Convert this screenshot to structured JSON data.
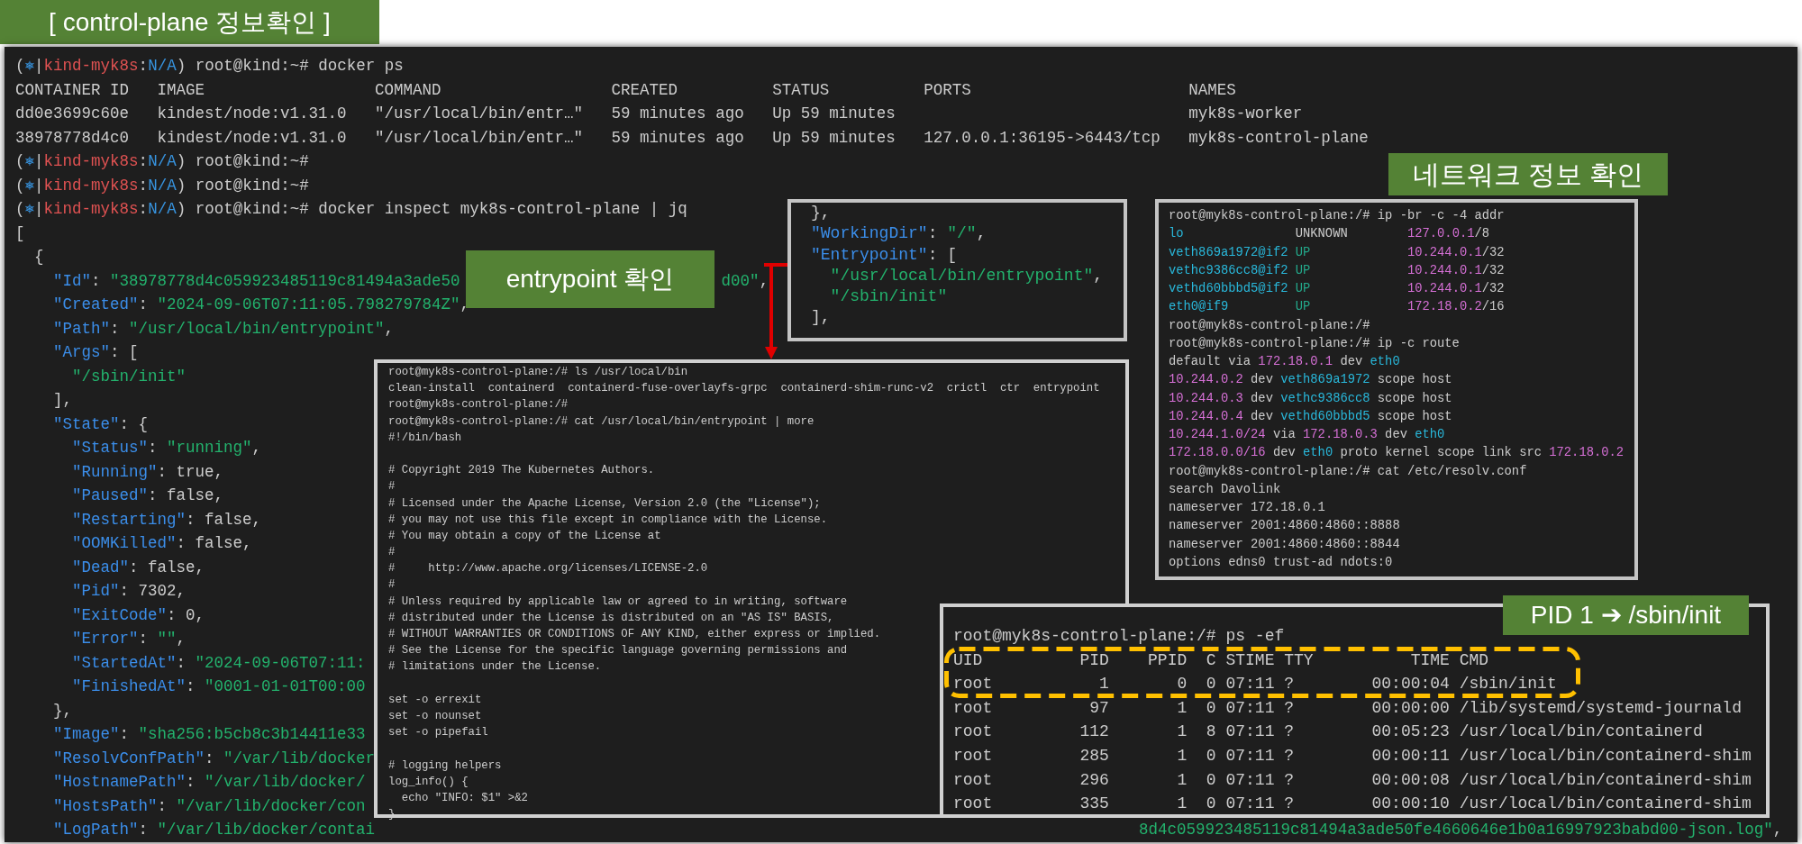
{
  "title_label": "[ control-plane 정보확인 ]",
  "main_terminal": {
    "lines": [
      {
        "segments": [
          {
            "text": "(",
            "kind": "p"
          },
          {
            "text": "⎈",
            "kind": "ns"
          },
          {
            "text": "|",
            "kind": "p"
          },
          {
            "text": "kind-myk8s",
            "kind": "ctx"
          },
          {
            "text": ":",
            "kind": "p"
          },
          {
            "text": "N/A",
            "kind": "ns"
          },
          {
            "text": ") root@kind:~# docker ps",
            "kind": "p"
          }
        ]
      },
      "CONTAINER ID   IMAGE                  COMMAND                  CREATED          STATUS          PORTS                       NAMES",
      "dd0e3699c60e   kindest/node:v1.31.0   \"/usr/local/bin/entr…\"   59 minutes ago   Up 59 minutes                               myk8s-worker",
      "38978778d4c0   kindest/node:v1.31.0   \"/usr/local/bin/entr…\"   59 minutes ago   Up 59 minutes   127.0.0.1:36195->6443/tcp   myk8s-control-plane",
      {
        "segments": [
          {
            "text": "(",
            "kind": "p"
          },
          {
            "text": "⎈",
            "kind": "ns"
          },
          {
            "text": "|",
            "kind": "p"
          },
          {
            "text": "kind-myk8s",
            "kind": "ctx"
          },
          {
            "text": ":",
            "kind": "p"
          },
          {
            "text": "N/A",
            "kind": "ns"
          },
          {
            "text": ") root@kind:~#",
            "kind": "p"
          }
        ]
      },
      {
        "segments": [
          {
            "text": "(",
            "kind": "p"
          },
          {
            "text": "⎈",
            "kind": "ns"
          },
          {
            "text": "|",
            "kind": "p"
          },
          {
            "text": "kind-myk8s",
            "kind": "ctx"
          },
          {
            "text": ":",
            "kind": "p"
          },
          {
            "text": "N/A",
            "kind": "ns"
          },
          {
            "text": ") root@kind:~#",
            "kind": "p"
          }
        ]
      },
      {
        "segments": [
          {
            "text": "(",
            "kind": "p"
          },
          {
            "text": "⎈",
            "kind": "ns"
          },
          {
            "text": "|",
            "kind": "p"
          },
          {
            "text": "kind-myk8s",
            "kind": "ctx"
          },
          {
            "text": ":",
            "kind": "p"
          },
          {
            "text": "N/A",
            "kind": "ns"
          },
          {
            "text": ") root@kind:~# docker inspect myk8s-control-plane | jq",
            "kind": "p"
          }
        ]
      },
      "[",
      "  {",
      {
        "segments": [
          {
            "text": "    \"Id\"",
            "kind": "key"
          },
          {
            "text": ": ",
            "kind": "p"
          },
          {
            "text": "\"38978778d4c059923485119c81494a3ade50",
            "kind": "str"
          }
        ],
        "after_label": [
          {
            "text": "d00\"",
            "kind": "str"
          },
          {
            "text": ",",
            "kind": "p"
          }
        ]
      },
      {
        "segments": [
          {
            "text": "    \"Created\"",
            "kind": "key"
          },
          {
            "text": ": ",
            "kind": "p"
          },
          {
            "text": "\"2024-09-06T07:11:05.798279784Z\"",
            "kind": "str"
          },
          {
            "text": ",",
            "kind": "p"
          }
        ]
      },
      {
        "segments": [
          {
            "text": "    \"Path\"",
            "kind": "key"
          },
          {
            "text": ": ",
            "kind": "p"
          },
          {
            "text": "\"/usr/local/bin/entrypoint\"",
            "kind": "str"
          },
          {
            "text": ",",
            "kind": "p"
          }
        ]
      },
      {
        "segments": [
          {
            "text": "    \"Args\"",
            "kind": "key"
          },
          {
            "text": ": [",
            "kind": "p"
          }
        ]
      },
      {
        "segments": [
          {
            "text": "      \"/sbin/init\"",
            "kind": "str"
          }
        ]
      },
      "    ],",
      {
        "segments": [
          {
            "text": "    \"State\"",
            "kind": "key"
          },
          {
            "text": ": {",
            "kind": "p"
          }
        ]
      },
      {
        "segments": [
          {
            "text": "      \"Status\"",
            "kind": "key"
          },
          {
            "text": ": ",
            "kind": "p"
          },
          {
            "text": "\"running\"",
            "kind": "str"
          },
          {
            "text": ",",
            "kind": "p"
          }
        ]
      },
      {
        "segments": [
          {
            "text": "      \"Running\"",
            "kind": "key"
          },
          {
            "text": ": true,",
            "kind": "p"
          }
        ]
      },
      {
        "segments": [
          {
            "text": "      \"Paused\"",
            "kind": "key"
          },
          {
            "text": ": false,",
            "kind": "p"
          }
        ]
      },
      {
        "segments": [
          {
            "text": "      \"Restarting\"",
            "kind": "key"
          },
          {
            "text": ": false,",
            "kind": "p"
          }
        ]
      },
      {
        "segments": [
          {
            "text": "      \"OOMKilled\"",
            "kind": "key"
          },
          {
            "text": ": false,",
            "kind": "p"
          }
        ]
      },
      {
        "segments": [
          {
            "text": "      \"Dead\"",
            "kind": "key"
          },
          {
            "text": ": false,",
            "kind": "p"
          }
        ]
      },
      {
        "segments": [
          {
            "text": "      \"Pid\"",
            "kind": "key"
          },
          {
            "text": ": 7302,",
            "kind": "p"
          }
        ]
      },
      {
        "segments": [
          {
            "text": "      \"ExitCode\"",
            "kind": "key"
          },
          {
            "text": ": 0,",
            "kind": "p"
          }
        ]
      },
      {
        "segments": [
          {
            "text": "      \"Error\"",
            "kind": "key"
          },
          {
            "text": ": ",
            "kind": "p"
          },
          {
            "text": "\"\"",
            "kind": "str"
          },
          {
            "text": ",",
            "kind": "p"
          }
        ]
      },
      {
        "segments": [
          {
            "text": "      \"StartedAt\"",
            "kind": "key"
          },
          {
            "text": ": ",
            "kind": "p"
          },
          {
            "text": "\"2024-09-06T07:11:",
            "kind": "str"
          }
        ]
      },
      {
        "segments": [
          {
            "text": "      \"FinishedAt\"",
            "kind": "key"
          },
          {
            "text": ": ",
            "kind": "p"
          },
          {
            "text": "\"0001-01-01T00:00",
            "kind": "str"
          }
        ]
      },
      "    },",
      {
        "segments": [
          {
            "text": "    \"Image\"",
            "kind": "key"
          },
          {
            "text": ": ",
            "kind": "p"
          },
          {
            "text": "\"sha256:b5cb8c3b14411e33",
            "kind": "str"
          }
        ]
      },
      {
        "segments": [
          {
            "text": "    \"ResolvConfPath\"",
            "kind": "key"
          },
          {
            "text": ": ",
            "kind": "p"
          },
          {
            "text": "\"/var/lib/docker",
            "kind": "str"
          }
        ]
      },
      {
        "segments": [
          {
            "text": "    \"HostnamePath\"",
            "kind": "key"
          },
          {
            "text": ": ",
            "kind": "p"
          },
          {
            "text": "\"/var/lib/docker/",
            "kind": "str"
          }
        ]
      },
      {
        "segments": [
          {
            "text": "    \"HostsPath\"",
            "kind": "key"
          },
          {
            "text": ": ",
            "kind": "p"
          },
          {
            "text": "\"/var/lib/docker/con",
            "kind": "str"
          }
        ]
      },
      {
        "segments": [
          {
            "text": "    \"LogPath\"",
            "kind": "key"
          },
          {
            "text": ": ",
            "kind": "p"
          },
          {
            "text": "\"/var/lib/docker/contai",
            "kind": "str"
          }
        ],
        "after_box": [
          {
            "text": "8d4c059923485119c81494a3ade50fe4660646e1b0a16997923babd00-json.log\"",
            "kind": "str"
          },
          {
            "text": ",",
            "kind": "p"
          }
        ]
      }
    ]
  },
  "entrypoint_label": "entrypoint 확인",
  "inspect_snippet": {
    "lines": [
      "},",
      {
        "segments": [
          {
            "text": "\"WorkingDir\"",
            "kind": "key"
          },
          {
            "text": ": ",
            "kind": "p"
          },
          {
            "text": "\"/\"",
            "kind": "str"
          },
          {
            "text": ",",
            "kind": "p"
          }
        ]
      },
      {
        "segments": [
          {
            "text": "\"Entrypoint\"",
            "kind": "key"
          },
          {
            "text": ": [",
            "kind": "p"
          }
        ]
      },
      {
        "segments": [
          {
            "text": "  \"/usr/local/bin/entrypoint\"",
            "kind": "str"
          },
          {
            "text": ",",
            "kind": "p"
          }
        ]
      },
      {
        "segments": [
          {
            "text": "  \"/sbin/init\"",
            "kind": "str"
          }
        ]
      },
      "],"
    ]
  },
  "bin_terminal": {
    "lines": [
      "root@myk8s-control-plane:/# ls /usr/local/bin",
      "clean-install  containerd  containerd-fuse-overlayfs-grpc  containerd-shim-runc-v2  crictl  ctr  entrypoint",
      "root@myk8s-control-plane:/#",
      "root@myk8s-control-plane:/# cat /usr/local/bin/entrypoint | more",
      "#!/bin/bash",
      {
        "kind": "blank"
      },
      "# Copyright 2019 The Kubernetes Authors.",
      "#",
      "# Licensed under the Apache License, Version 2.0 (the \"License\");",
      "# you may not use this file except in compliance with the License.",
      "# You may obtain a copy of the License at",
      "#",
      "#     http://www.apache.org/licenses/LICENSE-2.0",
      "#",
      "# Unless required by applicable law or agreed to in writing, software",
      "# distributed under the License is distributed on an \"AS IS\" BASIS,",
      "# WITHOUT WARRANTIES OR CONDITIONS OF ANY KIND, either express or implied.",
      "# See the License for the specific language governing permissions and",
      "# limitations under the License.",
      {
        "kind": "blank"
      },
      "set -o errexit",
      "set -o nounset",
      "set -o pipefail",
      {
        "kind": "blank"
      },
      "# logging helpers",
      "log_info() {",
      "  echo \"INFO: $1\" >&2",
      "}"
    ]
  },
  "network_label": "네트워크 정보 확인",
  "network_terminal": {
    "lines": [
      "root@myk8s-control-plane:/# ip -br -c -4 addr",
      {
        "segments": [
          {
            "text": "lo",
            "kind": "dev"
          },
          {
            "text": "               UNKNOWN        ",
            "kind": "p"
          },
          {
            "text": "127.0.0.1",
            "kind": "ip"
          },
          {
            "text": "/8",
            "kind": "p"
          }
        ]
      },
      {
        "segments": [
          {
            "text": "veth869a1972@if2",
            "kind": "dev"
          },
          {
            "text": " UP             ",
            "kind": "up"
          },
          {
            "text": "10.244.0.1",
            "kind": "ip"
          },
          {
            "text": "/32",
            "kind": "p"
          }
        ]
      },
      {
        "segments": [
          {
            "text": "vethc9386cc8@if2",
            "kind": "dev"
          },
          {
            "text": " UP             ",
            "kind": "up"
          },
          {
            "text": "10.244.0.1",
            "kind": "ip"
          },
          {
            "text": "/32",
            "kind": "p"
          }
        ]
      },
      {
        "segments": [
          {
            "text": "vethd60bbbd5@if2",
            "kind": "dev"
          },
          {
            "text": " UP             ",
            "kind": "up"
          },
          {
            "text": "10.244.0.1",
            "kind": "ip"
          },
          {
            "text": "/32",
            "kind": "p"
          }
        ]
      },
      {
        "segments": [
          {
            "text": "eth0@if9",
            "kind": "dev"
          },
          {
            "text": "         UP             ",
            "kind": "up"
          },
          {
            "text": "172.18.0.2",
            "kind": "ip"
          },
          {
            "text": "/16",
            "kind": "p"
          }
        ]
      },
      "root@myk8s-control-plane:/#",
      "root@myk8s-control-plane:/# ip -c route",
      {
        "segments": [
          {
            "text": "default via ",
            "kind": "p"
          },
          {
            "text": "172.18.0.1",
            "kind": "ip"
          },
          {
            "text": " dev ",
            "kind": "p"
          },
          {
            "text": "eth0",
            "kind": "dev"
          }
        ]
      },
      {
        "segments": [
          {
            "text": "10.244.0.2",
            "kind": "ip"
          },
          {
            "text": " dev ",
            "kind": "p"
          },
          {
            "text": "veth869a1972",
            "kind": "dev"
          },
          {
            "text": " scope host",
            "kind": "p"
          }
        ]
      },
      {
        "segments": [
          {
            "text": "10.244.0.3",
            "kind": "ip"
          },
          {
            "text": " dev ",
            "kind": "p"
          },
          {
            "text": "vethc9386cc8",
            "kind": "dev"
          },
          {
            "text": " scope host",
            "kind": "p"
          }
        ]
      },
      {
        "segments": [
          {
            "text": "10.244.0.4",
            "kind": "ip"
          },
          {
            "text": " dev ",
            "kind": "p"
          },
          {
            "text": "vethd60bbbd5",
            "kind": "dev"
          },
          {
            "text": " scope host",
            "kind": "p"
          }
        ]
      },
      {
        "segments": [
          {
            "text": "10.244.1.0/24",
            "kind": "ip"
          },
          {
            "text": " via ",
            "kind": "p"
          },
          {
            "text": "172.18.0.3",
            "kind": "ip"
          },
          {
            "text": " dev ",
            "kind": "p"
          },
          {
            "text": "eth0",
            "kind": "dev"
          }
        ]
      },
      {
        "segments": [
          {
            "text": "172.18.0.0/16",
            "kind": "ip"
          },
          {
            "text": " dev ",
            "kind": "p"
          },
          {
            "text": "eth0",
            "kind": "dev"
          },
          {
            "text": " proto kernel scope link src ",
            "kind": "p"
          },
          {
            "text": "172.18.0.2",
            "kind": "ip"
          }
        ]
      },
      "root@myk8s-control-plane:/# cat /etc/resolv.conf",
      "search Davolink",
      "nameserver 172.18.0.1",
      "nameserver 2001:4860:4860::8888",
      "nameserver 2001:4860:4860::8844",
      "options edns0 trust-ad ndots:0"
    ]
  },
  "ps_terminal": {
    "lines": [
      "root@myk8s-control-plane:/# ps -ef",
      "UID          PID    PPID  C STIME TTY          TIME CMD",
      "root           1       0  0 07:11 ?        00:00:04 /sbin/init",
      "root          97       1  0 07:11 ?        00:00:00 /lib/systemd/systemd-journald",
      "root         112       1  8 07:11 ?        00:05:23 /usr/local/bin/containerd",
      "root         285       1  0 07:11 ?        00:00:11 /usr/local/bin/containerd-shim",
      "root         296       1  0 07:11 ?        00:00:08 /usr/local/bin/containerd-shim",
      "root         335       1  0 07:11 ?        00:00:10 /usr/local/bin/containerd-shim"
    ]
  },
  "pid_label": "PID 1 ➔ /sbin/init"
}
